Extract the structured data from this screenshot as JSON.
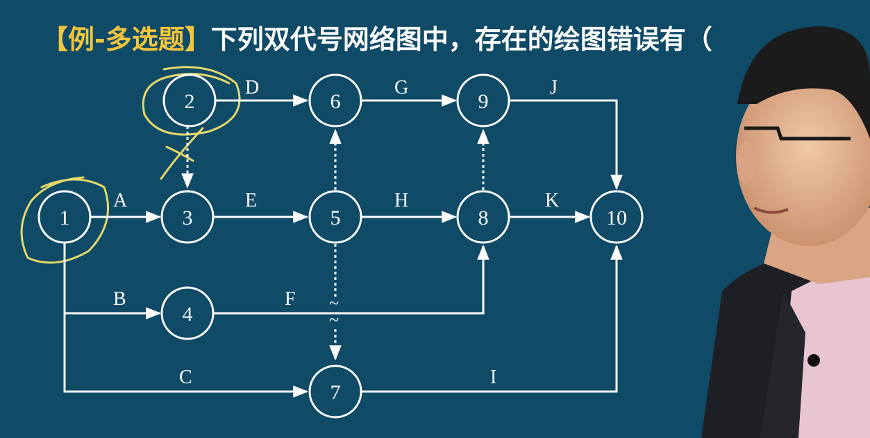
{
  "title": {
    "tag": "【例-多选题】",
    "text": "下列双代号网络图中，存在的绘图错误有（"
  },
  "diagram": {
    "nodes": [
      "1",
      "2",
      "3",
      "4",
      "5",
      "6",
      "7",
      "8",
      "9",
      "10"
    ],
    "activities": [
      {
        "label": "A",
        "from": "1",
        "to": "3"
      },
      {
        "label": "B",
        "from": "1",
        "to": "4"
      },
      {
        "label": "C",
        "from": "1",
        "to": "7"
      },
      {
        "label": "D",
        "from": "2",
        "to": "6"
      },
      {
        "label": "E",
        "from": "3",
        "to": "5"
      },
      {
        "label": "F",
        "from": "4",
        "to": "8"
      },
      {
        "label": "G",
        "from": "6",
        "to": "9"
      },
      {
        "label": "H",
        "from": "5",
        "to": "8"
      },
      {
        "label": "I",
        "from": "7",
        "to": "10"
      },
      {
        "label": "J",
        "from": "9",
        "to": "10"
      },
      {
        "label": "K",
        "from": "8",
        "to": "10"
      }
    ],
    "dummy_activities": [
      {
        "from": "2",
        "to": "3"
      },
      {
        "from": "5",
        "to": "6"
      },
      {
        "from": "5",
        "to": "7"
      },
      {
        "from": "8",
        "to": "9"
      }
    ],
    "break_mark": "~",
    "colors": {
      "background": "#0f4a67",
      "line": "#ffffff",
      "annotation": "#e6d96a",
      "title_tag": "#f2c53d"
    }
  },
  "presenter": {
    "description": "lecturer"
  }
}
